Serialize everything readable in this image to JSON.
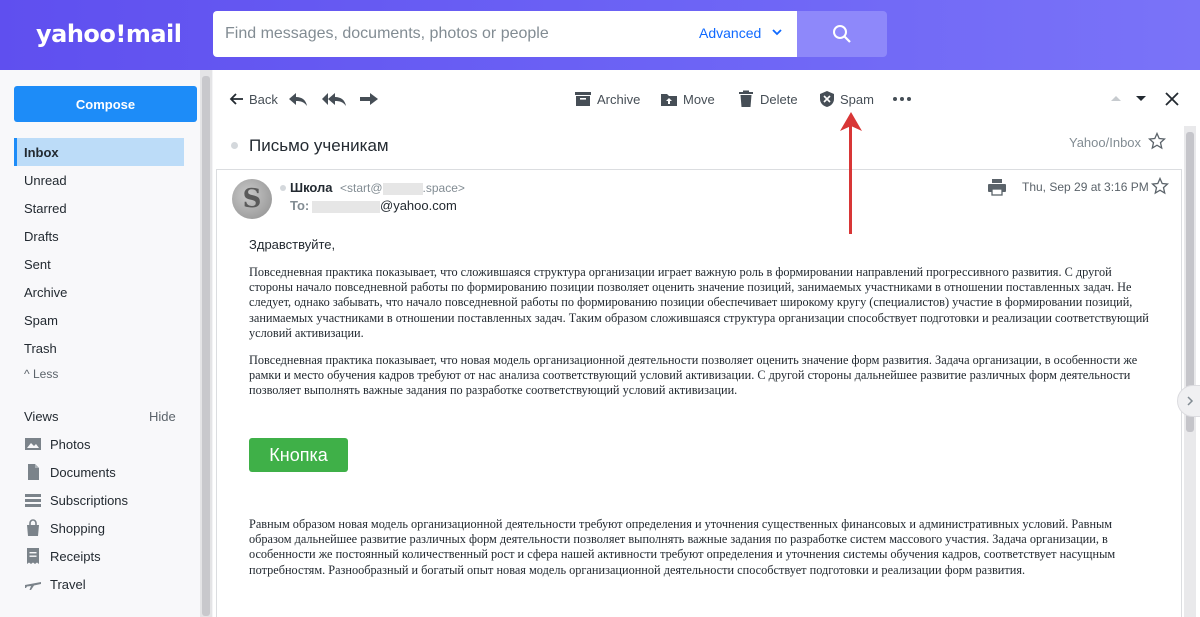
{
  "header": {
    "logo": "yahoo!mail",
    "search_placeholder": "Find messages, documents, photos or people",
    "advanced": "Advanced"
  },
  "sidebar": {
    "compose": "Compose",
    "folders": [
      "Inbox",
      "Unread",
      "Starred",
      "Drafts",
      "Sent",
      "Archive",
      "Spam",
      "Trash"
    ],
    "less": "^ Less",
    "views_title": "Views",
    "views_hide": "Hide",
    "views": [
      "Photos",
      "Documents",
      "Subscriptions",
      "Shopping",
      "Receipts",
      "Travel"
    ]
  },
  "toolbar": {
    "back": "Back",
    "archive": "Archive",
    "move": "Move",
    "delete": "Delete",
    "spam": "Spam"
  },
  "message": {
    "subject": "Письмо ученикам",
    "folder": "Yahoo/Inbox",
    "avatar_letter": "S",
    "sender_name": "Школа",
    "sender_email_start": "<start@",
    "sender_email_end": ".space>",
    "to_label": "To:",
    "to_domain": "@yahoo.com",
    "date": "Thu, Sep 29 at 3:16 PM",
    "greeting": "Здравствуйте,",
    "para1": "Повседневная практика показывает, что сложившаяся структура организации играет важную роль в формировании направлений прогрессивного развития. С другой стороны начало повседневной работы по формированию позиции позволяет оценить значение позиций, занимаемых участниками в отношении поставленных задач. Не следует, однако забывать, что начало повседневной работы по формированию позиции обеспечивает широкому кругу (специалистов) участие в формировании позиций, занимаемых участниками в отношении поставленных задач. Таким образом сложившаяся структура организации способствует подготовки и реализации соответствующий условий активизации.",
    "para2": "Повседневная практика показывает, что новая модель организационной деятельности позволяет оценить значение форм развития. Задача организации, в особенности же рамки и место обучения кадров требуют от нас анализа соответствующий условий активизации. С другой стороны дальнейшее развитие различных форм деятельности позволяет выполнять важные задания по разработке соответствующий условий активизации.",
    "button": "Кнопка",
    "para3": "Равным образом новая модель организационной деятельности требуют определения и уточнения существенных финансовых и административных условий. Равным образом дальнейшее развитие различных форм деятельности позволяет выполнять важные задания по разработке систем массового участия. Задача организации, в особенности же постоянный количественный рост и сфера нашей активности требуют определения и уточнения системы обучения кадров, соответствует насущным потребностям. Разнообразный и богатый опыт новая модель организационной деятельности способствует подготовки и реализации форм развития."
  },
  "colors": {
    "header": "#6c63f5",
    "compose": "#1d8cf8",
    "active_folder": "#bcdcf8",
    "cta_button": "#3fb048",
    "annotation_arrow": "#d83636"
  }
}
